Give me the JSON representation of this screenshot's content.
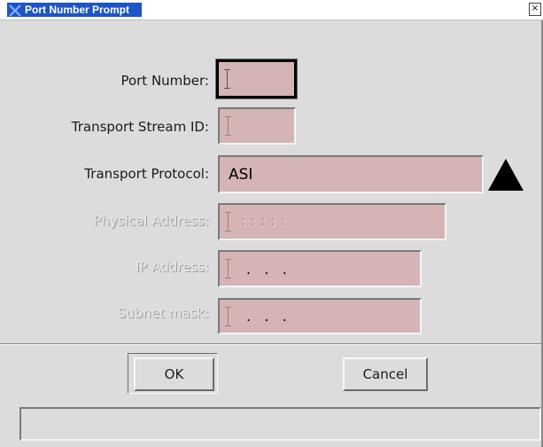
{
  "window": {
    "title": "Port Number Prompt",
    "close_glyph": "×"
  },
  "form": {
    "port_number": {
      "label": "Port Number:",
      "value": ""
    },
    "transport_stream_id": {
      "label": "Transport Stream ID:",
      "value": ""
    },
    "transport_protocol": {
      "label": "Transport Protocol:",
      "value": "ASI"
    },
    "physical_address": {
      "label": "Physical Address:",
      "value": ": : : : :"
    },
    "ip_address": {
      "label": "IP Address:",
      "value": ".   .   ."
    },
    "subnet_mask": {
      "label": "Subnet mask:",
      "value": ".   .   ."
    }
  },
  "buttons": {
    "ok_label": "OK",
    "cancel_label": "Cancel"
  },
  "status": {
    "text": ""
  },
  "colors": {
    "title_bar": "#1d54c8",
    "dialog_bg": "#dcdcdc",
    "field_bg": "#d4b4b4"
  },
  "icons": {
    "title": "x-window-icon",
    "dropdown": "triangle-up-icon",
    "close": "close-icon"
  }
}
